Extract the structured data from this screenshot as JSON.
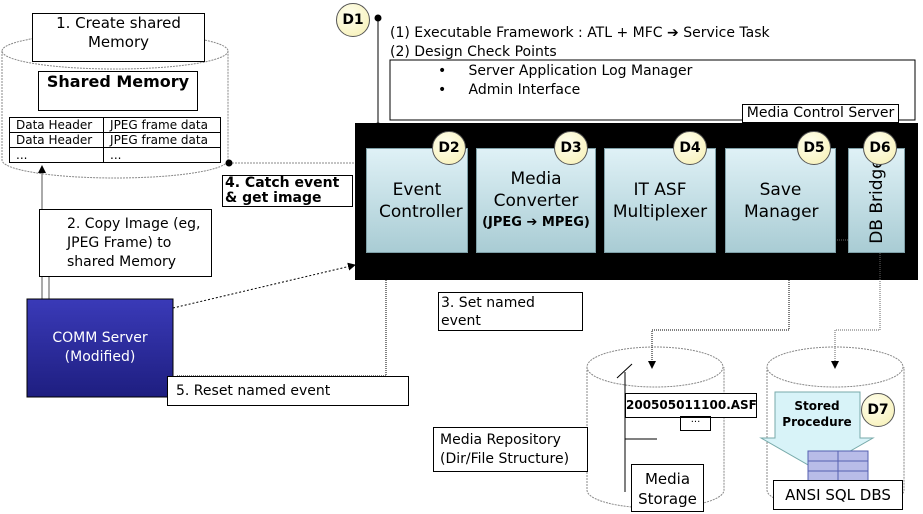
{
  "shared_memory": {
    "create_label": "1. Create shared Memory",
    "title": "Shared Memory",
    "rows": [
      [
        "Data Header",
        "JPEG frame data"
      ],
      [
        "Data Header",
        "JPEG frame data"
      ],
      [
        "...",
        "..."
      ]
    ]
  },
  "steps": {
    "copy_image": "2. Copy Image (eg, JPEG Frame) to shared Memory",
    "set_event": "3. Set named event",
    "catch_event": "4. Catch event & get image",
    "reset_event": "5. Reset named event"
  },
  "comm_server": {
    "label": "COMM Server (Modified)",
    "color": "#2b2b9c"
  },
  "notes": {
    "line1": "(1)   Executable Framework  : ATL + MFC ➔ Service Task",
    "line2": "(2)   Design Check Points",
    "bullet1": "Server Application  Log Manager",
    "bullet2": "Admin Interface"
  },
  "server": {
    "title": "Media Control Server",
    "modules": [
      {
        "badge": "D2",
        "label": "Event Controller"
      },
      {
        "badge": "D3",
        "label": "Media Converter",
        "sub": "(JPEG ➔ MPEG)"
      },
      {
        "badge": "D4",
        "label": "IT ASF Multiplexer"
      },
      {
        "badge": "D5",
        "label": "Save Manager"
      },
      {
        "badge": "D6",
        "label": "DB Bridge"
      }
    ]
  },
  "badge_d1": "D1",
  "media_storage": {
    "file": "200505011100.ASF",
    "ellipsis": "...",
    "label": "Media Storage",
    "repository": "Media Repository (Dir/File Structure)"
  },
  "database": {
    "badge": "D7",
    "procedure": "Stored Procedure",
    "label": "ANSI SQL DBS"
  }
}
